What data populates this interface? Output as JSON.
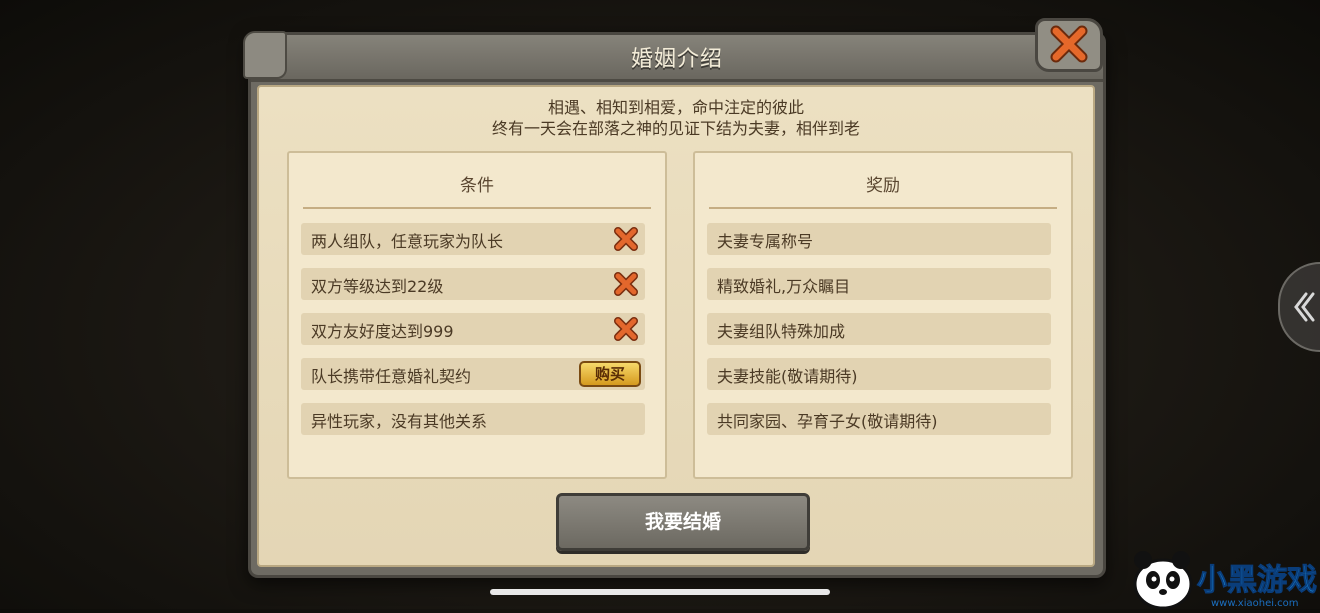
{
  "dialog": {
    "title": "婚姻介绍",
    "intro_line1": "相遇、相知到相爱，命中注定的彼此",
    "intro_line2": "终有一天会在部落之神的见证下结为夫妻，相伴到老"
  },
  "conditions": {
    "header": "条件",
    "items": [
      {
        "label": "两人组队，任意玩家为队长",
        "status": "x-icon"
      },
      {
        "label": "双方等级达到22级",
        "status": "x-icon"
      },
      {
        "label": "双方友好度达到999",
        "status": "x-icon"
      },
      {
        "label": "队长携带任意婚礼契约",
        "status": "buy-button"
      },
      {
        "label": "异性玩家，没有其他关系",
        "status": "none"
      }
    ],
    "buy_label": "购买"
  },
  "rewards": {
    "header": "奖励",
    "items": [
      {
        "label": "夫妻专属称号"
      },
      {
        "label": "精致婚礼,万众瞩目"
      },
      {
        "label": "夫妻组队特殊加成"
      },
      {
        "label": "夫妻技能(敬请期待)"
      },
      {
        "label": "共同家园、孕育子女(敬请期待)"
      }
    ]
  },
  "actions": {
    "marry_label": "我要结婚"
  },
  "watermark": {
    "text": "小黑游戏",
    "url": "www.xiaohei.com"
  },
  "colors": {
    "parchment": "#ece0c2",
    "frame": "#6e6b63",
    "x_icon": "#e3672c",
    "buy_button": "#e9b83c"
  }
}
